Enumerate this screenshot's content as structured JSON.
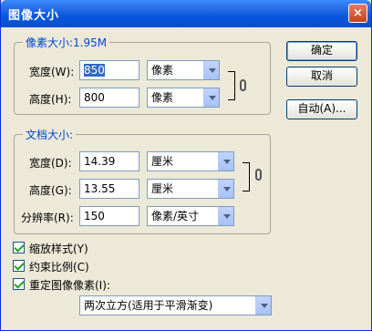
{
  "window": {
    "title": "图像大小"
  },
  "title_close": "×",
  "pixel_group": {
    "title": "像素大小:1.95M",
    "width_label": "宽度(W):",
    "width_value": "850",
    "width_unit": "像素",
    "height_label": "高度(H):",
    "height_value": "800",
    "height_unit": "像素"
  },
  "doc_group": {
    "title": "文档大小:",
    "width_label": "宽度(D):",
    "width_value": "14.39",
    "width_unit": "厘米",
    "height_label": "高度(G):",
    "height_value": "13.55",
    "height_unit": "厘米",
    "res_label": "分辨率(R):",
    "res_value": "150",
    "res_unit": "像素/英寸"
  },
  "buttons": {
    "ok": "确定",
    "cancel": "取消",
    "auto": "自动(A)..."
  },
  "options": {
    "scale_styles": "缩放样式(Y)",
    "constrain": "约束比例(C)",
    "resample": "重定图像像素(I):",
    "resample_method": "两次立方(适用于平滑渐变)"
  }
}
